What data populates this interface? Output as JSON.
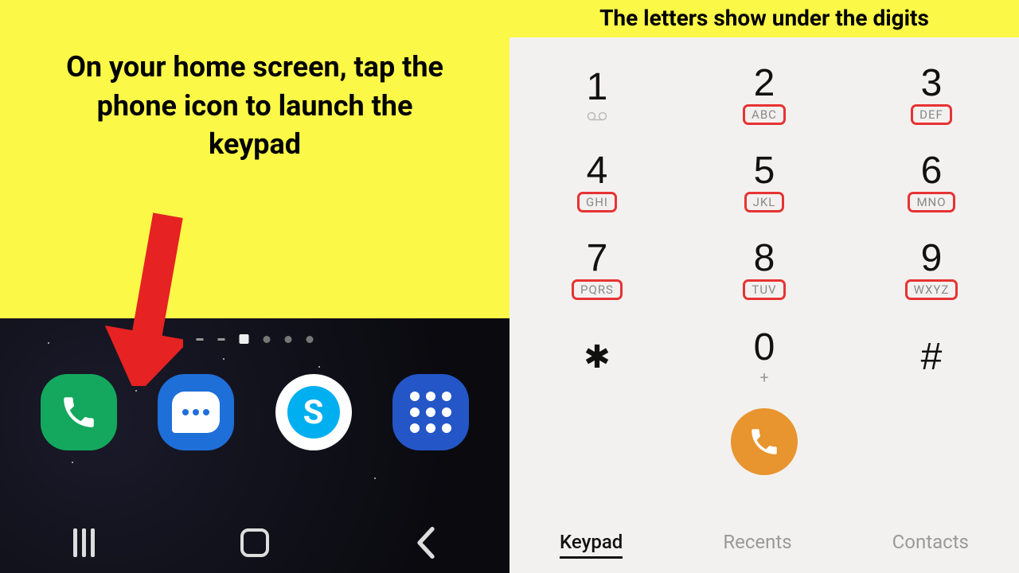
{
  "left": {
    "instruction": "On your home screen, tap the phone icon to launch the keypad"
  },
  "right": {
    "title": "The letters show under the digits"
  },
  "keypad": {
    "k1": {
      "digit": "1"
    },
    "k2": {
      "digit": "2",
      "letters": "ABC"
    },
    "k3": {
      "digit": "3",
      "letters": "DEF"
    },
    "k4": {
      "digit": "4",
      "letters": "GHI"
    },
    "k5": {
      "digit": "5",
      "letters": "JKL"
    },
    "k6": {
      "digit": "6",
      "letters": "MNO"
    },
    "k7": {
      "digit": "7",
      "letters": "PQRS"
    },
    "k8": {
      "digit": "8",
      "letters": "TUV"
    },
    "k9": {
      "digit": "9",
      "letters": "WXYZ"
    },
    "kstar": {
      "digit": "✱"
    },
    "k0": {
      "digit": "0",
      "sub": "+"
    },
    "khash": {
      "digit": "#"
    }
  },
  "tabs": {
    "keypad": "Keypad",
    "recents": "Recents",
    "contacts": "Contacts"
  }
}
